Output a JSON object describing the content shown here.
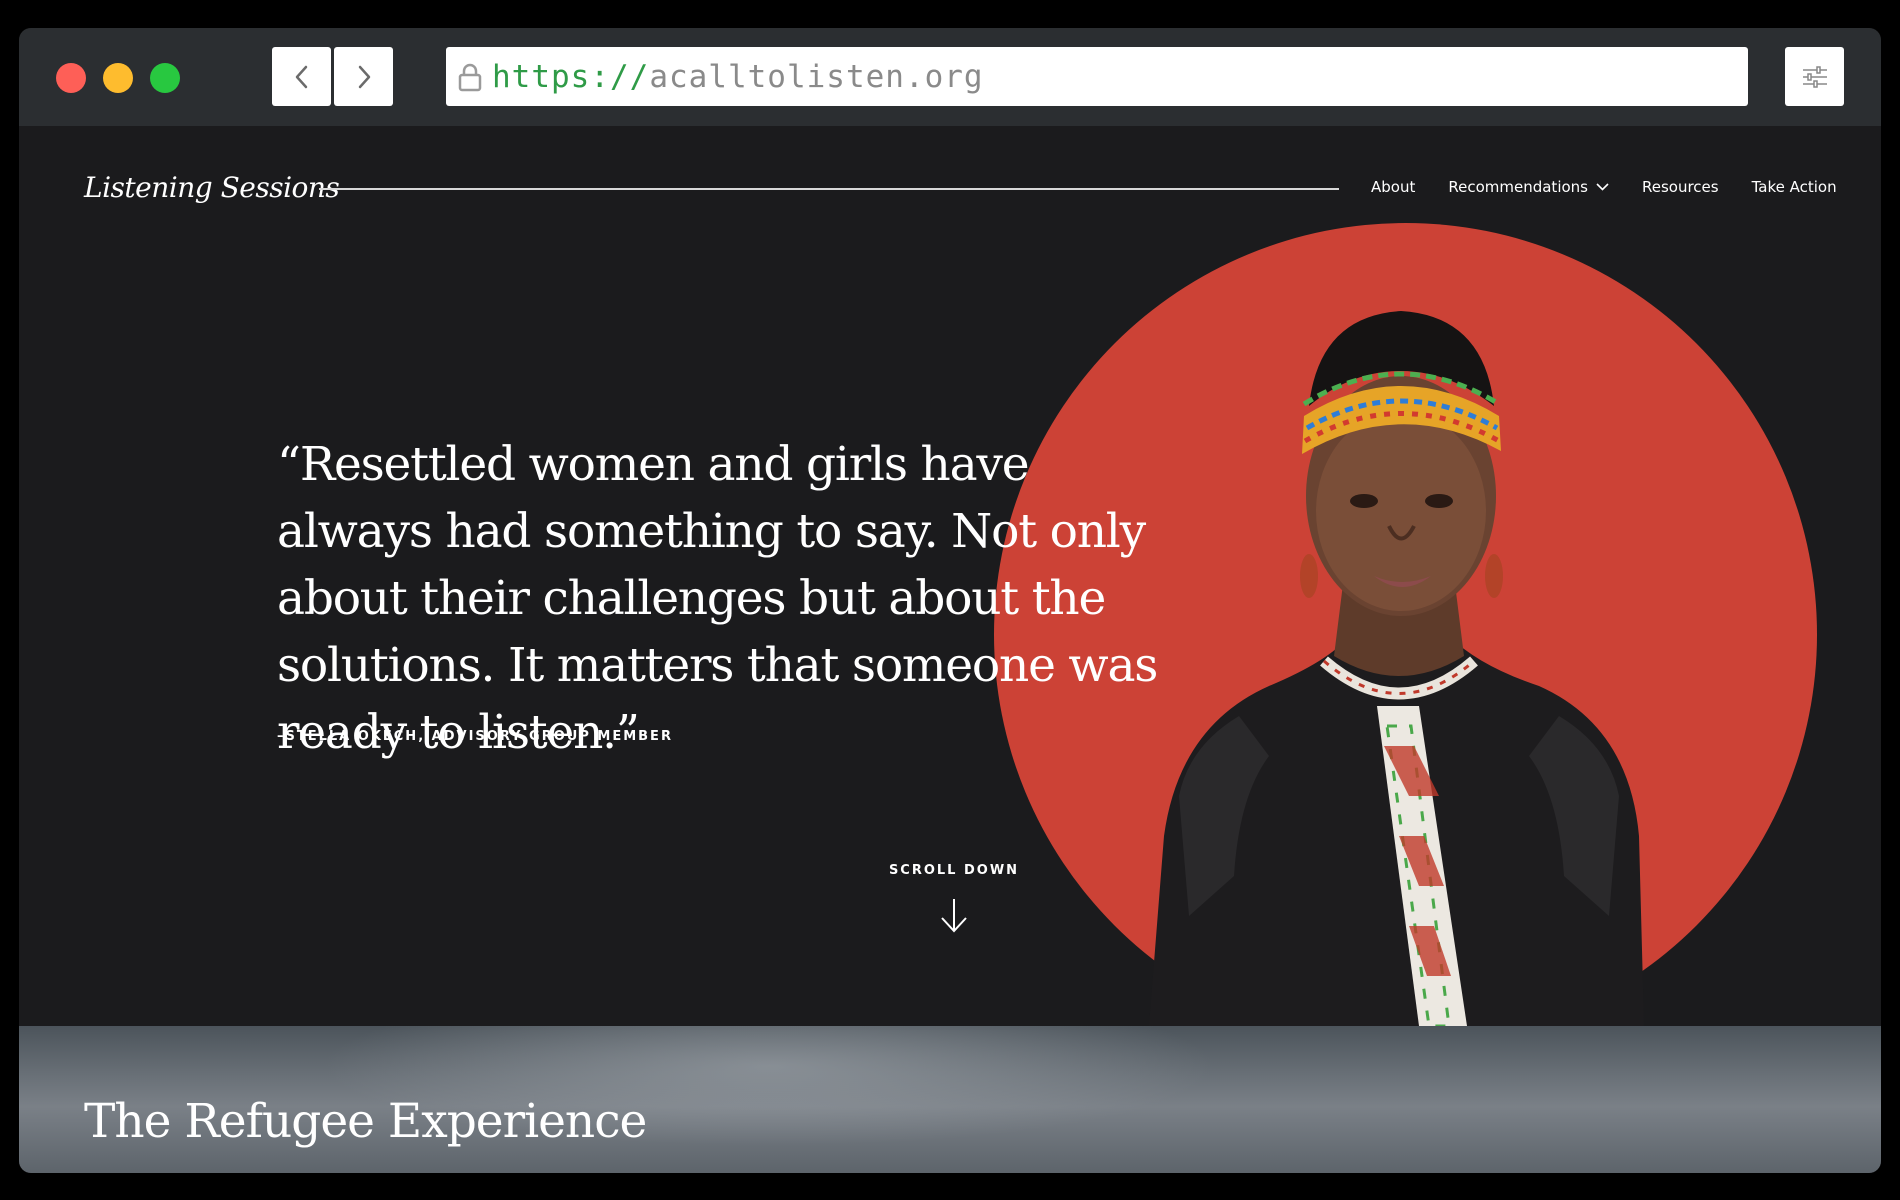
{
  "browser": {
    "url_scheme": "https://",
    "url_host": "acalltolisten.org",
    "traffic_lights": {
      "close": "#fe5f57",
      "minimize": "#febc2e",
      "maximize": "#28c840"
    }
  },
  "header": {
    "brand": "Listening Sessions",
    "nav": [
      {
        "label": "About"
      },
      {
        "label": "Recommendations",
        "has_dropdown": true
      },
      {
        "label": "Resources"
      },
      {
        "label": "Take Action"
      }
    ]
  },
  "hero": {
    "quote": "“Resettled women and girls have always had something to say. Not only about their challenges but about the solutions. It matters that someone was ready to listen.”",
    "attribution": "–STELLA OKECH, ADVISORY GROUP MEMBER",
    "scroll_label": "SCROLL DOWN",
    "accent_color": "#cc4236",
    "background_color": "#1b1b1d"
  },
  "section2": {
    "title": "The Refugee Experience"
  }
}
